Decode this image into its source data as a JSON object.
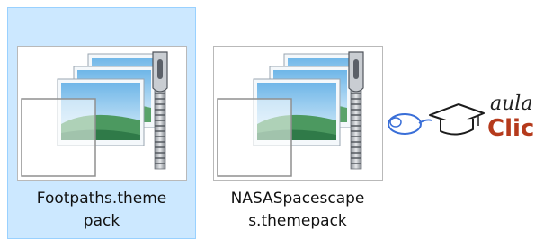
{
  "files": [
    {
      "name": "Footpaths.theme\npack",
      "selected": true,
      "icon": "themepack-zip-icon"
    },
    {
      "name": "NASASpacescape\ns.themepack",
      "selected": false,
      "icon": "themepack-zip-icon"
    }
  ],
  "logo": {
    "top_text": "aula",
    "bottom_text": "Clic",
    "icon": "mouse-graduation-cap-icon"
  },
  "colors": {
    "selection_bg": "#cce8ff",
    "selection_border": "#99d1ff",
    "logo_accent": "#b53a1c",
    "logo_blue": "#3a6fd8"
  }
}
